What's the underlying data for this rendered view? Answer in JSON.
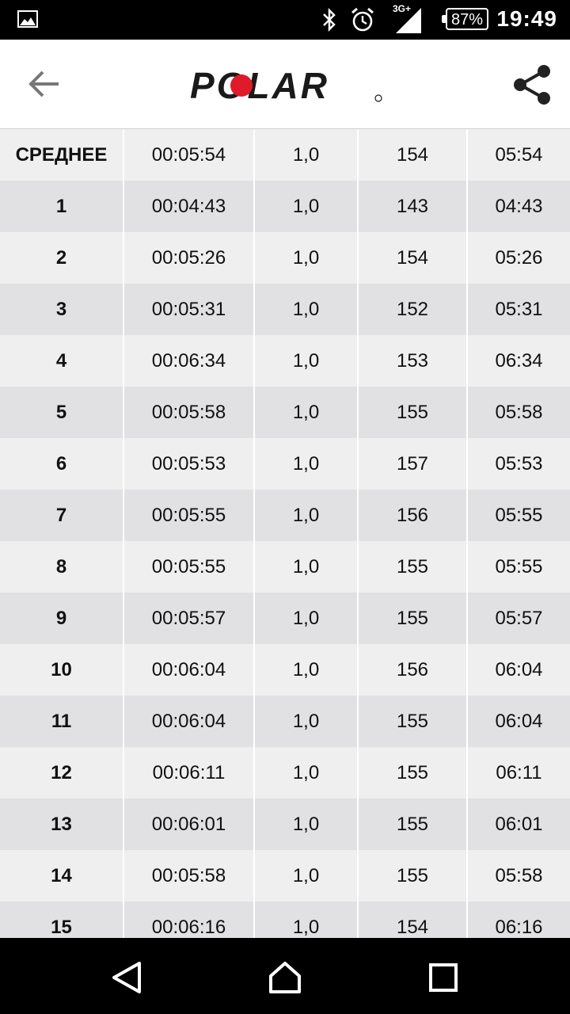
{
  "status_bar": {
    "network_label": "3G+",
    "battery": "87%",
    "time": "19:49"
  },
  "app_bar": {
    "logo_text": "POLAR",
    "logo_colors": {
      "text": "#1a1a1a",
      "accent": "#e0192b"
    }
  },
  "table": {
    "rows": [
      {
        "label": "СРЕДНЕЕ",
        "time": "00:05:54",
        "distance": "1,0",
        "hr": "154",
        "pace": "05:54"
      },
      {
        "label": "1",
        "time": "00:04:43",
        "distance": "1,0",
        "hr": "143",
        "pace": "04:43"
      },
      {
        "label": "2",
        "time": "00:05:26",
        "distance": "1,0",
        "hr": "154",
        "pace": "05:26"
      },
      {
        "label": "3",
        "time": "00:05:31",
        "distance": "1,0",
        "hr": "152",
        "pace": "05:31"
      },
      {
        "label": "4",
        "time": "00:06:34",
        "distance": "1,0",
        "hr": "153",
        "pace": "06:34"
      },
      {
        "label": "5",
        "time": "00:05:58",
        "distance": "1,0",
        "hr": "155",
        "pace": "05:58"
      },
      {
        "label": "6",
        "time": "00:05:53",
        "distance": "1,0",
        "hr": "157",
        "pace": "05:53"
      },
      {
        "label": "7",
        "time": "00:05:55",
        "distance": "1,0",
        "hr": "156",
        "pace": "05:55"
      },
      {
        "label": "8",
        "time": "00:05:55",
        "distance": "1,0",
        "hr": "155",
        "pace": "05:55"
      },
      {
        "label": "9",
        "time": "00:05:57",
        "distance": "1,0",
        "hr": "155",
        "pace": "05:57"
      },
      {
        "label": "10",
        "time": "00:06:04",
        "distance": "1,0",
        "hr": "156",
        "pace": "06:04"
      },
      {
        "label": "11",
        "time": "00:06:04",
        "distance": "1,0",
        "hr": "155",
        "pace": "06:04"
      },
      {
        "label": "12",
        "time": "00:06:11",
        "distance": "1,0",
        "hr": "155",
        "pace": "06:11"
      },
      {
        "label": "13",
        "time": "00:06:01",
        "distance": "1,0",
        "hr": "155",
        "pace": "06:01"
      },
      {
        "label": "14",
        "time": "00:05:58",
        "distance": "1,0",
        "hr": "155",
        "pace": "05:58"
      },
      {
        "label": "15",
        "time": "00:06:16",
        "distance": "1,0",
        "hr": "154",
        "pace": "06:16"
      }
    ]
  },
  "nav_bar": {
    "icons": [
      "back-triangle-icon",
      "home-icon",
      "recents-square-icon"
    ]
  }
}
